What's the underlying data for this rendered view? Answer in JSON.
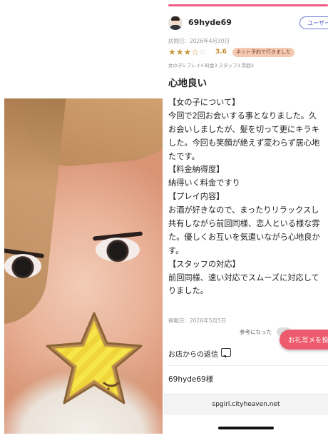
{
  "photo": {
    "overlay_icon": "star-sticker-icon"
  },
  "review": {
    "username": "69hyde69",
    "user_button_label": "ユーザー",
    "visit_date": "訪問日：2026年4月30日",
    "rating_score": "3.6",
    "rating_value": 3.6,
    "rating_max": 5,
    "booking_badge": "ネット予約で行きました",
    "sub_ratings": "女の子5 プレイ4 料金3 スタッフ3 雰囲3",
    "title": "心地良い",
    "body_lines": [
      "【女の子について】",
      "今回で2回お会いする事となりました。久",
      "お会いしましたが、髪を切って更にキラキ",
      "した。今回も笑顔が絶えず変わらず居心地",
      "たです。",
      "【料金納得度】",
      "納得いく料金ですり",
      "【プレイ内容】",
      "お酒が好きなので、まったりリラックスし",
      "共有しながら前回同様、恋人といる様な雰",
      "た。優しくお互いを気遣いながら心地良か",
      "す。",
      "【スタッフの対応】",
      "前回同様、速い対応でスムーズに対応して",
      "りました。"
    ],
    "post_date": "掲載日：2026年5月5日",
    "helpful_label": "参考になった",
    "thanks_button": "お礼写メを投",
    "shop_reply_label": "お店からの返信",
    "signoff": "69hyde69様"
  },
  "browser": {
    "url": "spgirl.cityheaven.net"
  },
  "colors": {
    "accent_pink": "#f05a86",
    "star_gold": "#c69a3c",
    "badge_bg": "#f4c9b1",
    "thanks_red": "#ee5a6d",
    "user_button_blue": "#4a5acb"
  }
}
